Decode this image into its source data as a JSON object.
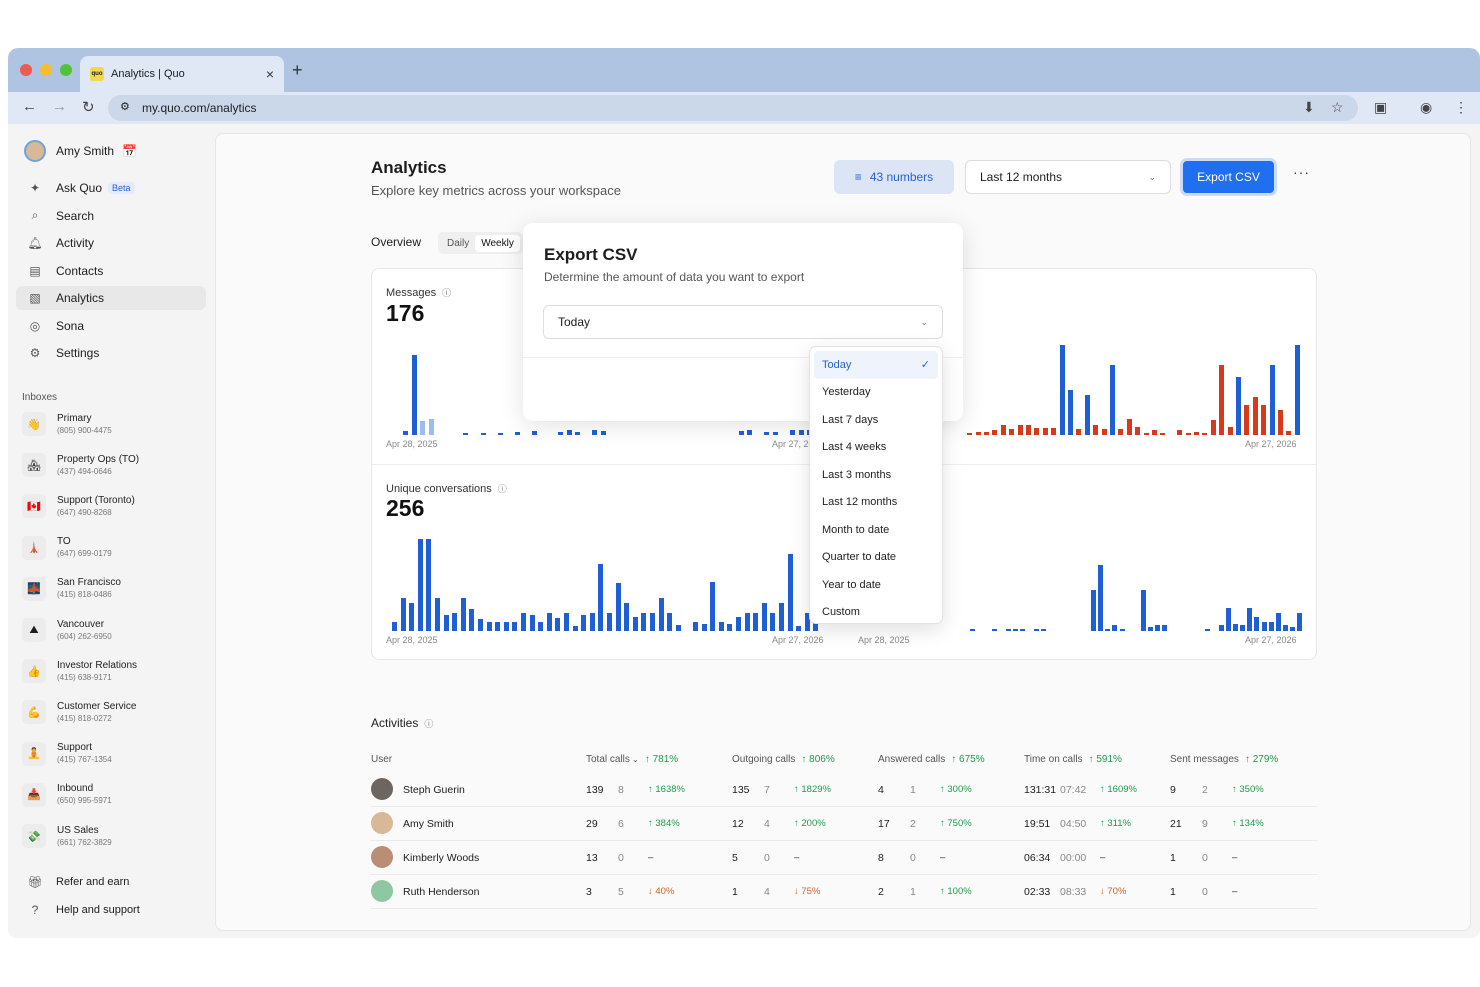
{
  "browser": {
    "tab_title": "Analytics | Quo",
    "favicon_text": "quo",
    "url": "my.quo.com/analytics"
  },
  "sidebar": {
    "user_name": "Amy Smith",
    "nav": [
      {
        "label": "Ask Quo",
        "badge": "Beta",
        "icon": "sparkle-icon"
      },
      {
        "label": "Search",
        "icon": "search-icon"
      },
      {
        "label": "Activity",
        "icon": "bell-icon"
      },
      {
        "label": "Contacts",
        "icon": "contacts-icon"
      },
      {
        "label": "Analytics",
        "icon": "analytics-icon",
        "active": true
      },
      {
        "label": "Sona",
        "icon": "sona-icon"
      },
      {
        "label": "Settings",
        "icon": "gear-icon"
      }
    ],
    "inboxes_heading": "Inboxes",
    "inboxes": [
      {
        "emoji": "👋",
        "name": "Primary",
        "phone": "(805) 900-4475"
      },
      {
        "emoji": "🏘",
        "name": "Property Ops (TO)",
        "phone": "(437) 494-0646"
      },
      {
        "emoji": "🇨🇦",
        "name": "Support (Toronto)",
        "phone": "(647) 490-8268"
      },
      {
        "emoji": "🗼",
        "name": "TO",
        "phone": "(647) 699-0179"
      },
      {
        "emoji": "🌉",
        "name": "San Francisco",
        "phone": "(415) 818-0486"
      },
      {
        "emoji": "⛰",
        "name": "Vancouver",
        "phone": "(604) 262-6950"
      },
      {
        "emoji": "👍",
        "name": "Investor Relations",
        "phone": "(415) 638-9171"
      },
      {
        "emoji": "💪",
        "name": "Customer Service",
        "phone": "(415) 818-0272"
      },
      {
        "emoji": "🧘",
        "name": "Support",
        "phone": "(415) 767-1354"
      },
      {
        "emoji": "📥",
        "name": "Inbound",
        "phone": "(650) 995-5971"
      },
      {
        "emoji": "💸",
        "name": "US Sales",
        "phone": "(661) 762-3829"
      }
    ],
    "bottom": [
      {
        "label": "Refer and earn",
        "icon": "gift-icon"
      },
      {
        "label": "Help and support",
        "icon": "help-icon"
      }
    ]
  },
  "header": {
    "title": "Analytics",
    "subtitle": "Explore key metrics across your workspace",
    "numbers_label": "43 numbers",
    "range_label": "Last 12 months",
    "export_label": "Export CSV"
  },
  "overview": {
    "label": "Overview",
    "segments": [
      "Daily",
      "Weekly"
    ]
  },
  "charts": {
    "messages": {
      "label": "Messages",
      "value": "176",
      "start": "Apr 28, 2025",
      "end": "Apr 27, 2026"
    },
    "right_top": {
      "end": "Apr 27, 2026"
    },
    "conversations": {
      "label": "Unique conversations",
      "value": "256",
      "start": "Apr 28, 2025",
      "end": "Apr 27, 2026"
    },
    "right_bottom": {
      "start": "Apr 28, 2025",
      "end": "Apr 27, 2026"
    },
    "colors": {
      "blue": "#1f5fd6",
      "light_blue": "#9bbcec",
      "red": "#d63a1a"
    }
  },
  "activities": {
    "title": "Activities",
    "headers": [
      {
        "label": "User",
        "pct": ""
      },
      {
        "label": "Total calls",
        "pct": "↑ 781%"
      },
      {
        "label": "Outgoing calls",
        "pct": "↑ 806%"
      },
      {
        "label": "Answered calls",
        "pct": "↑ 675%"
      },
      {
        "label": "Time on calls",
        "pct": "↑ 591%"
      },
      {
        "label": "Sent messages",
        "pct": "↑ 279%"
      }
    ],
    "rows": [
      {
        "name": "Steph Guerin",
        "tc": [
          "139",
          "8",
          "↑ 1638%"
        ],
        "oc": [
          "135",
          "7",
          "↑ 1829%"
        ],
        "ac": [
          "4",
          "1",
          "↑ 300%"
        ],
        "tt": [
          "131:31",
          "07:42",
          "↑ 1609%"
        ],
        "sm": [
          "9",
          "2",
          "↑ 350%"
        ]
      },
      {
        "name": "Amy Smith",
        "tc": [
          "29",
          "6",
          "↑ 384%"
        ],
        "oc": [
          "12",
          "4",
          "↑ 200%"
        ],
        "ac": [
          "17",
          "2",
          "↑ 750%"
        ],
        "tt": [
          "19:51",
          "04:50",
          "↑ 311%"
        ],
        "sm": [
          "21",
          "9",
          "↑ 134%"
        ]
      },
      {
        "name": "Kimberly Woods",
        "tc": [
          "13",
          "0",
          "–"
        ],
        "oc": [
          "5",
          "0",
          "–"
        ],
        "ac": [
          "8",
          "0",
          "–"
        ],
        "tt": [
          "06:34",
          "00:00",
          "–"
        ],
        "sm": [
          "1",
          "0",
          "–"
        ]
      },
      {
        "name": "Ruth Henderson",
        "tc": [
          "3",
          "5",
          "↓ 40%"
        ],
        "oc": [
          "1",
          "4",
          "↓ 75%"
        ],
        "ac": [
          "2",
          "1",
          "↑ 100%"
        ],
        "tt": [
          "02:33",
          "08:33",
          "↓ 70%"
        ],
        "sm": [
          "1",
          "0",
          "–"
        ]
      }
    ]
  },
  "modal": {
    "title": "Export CSV",
    "subtitle": "Determine the amount of data you want to export",
    "selected": "Today",
    "options": [
      "Today",
      "Yesterday",
      "Last 7 days",
      "Last 4 weeks",
      "Last 3 months",
      "Last 12 months",
      "Month to date",
      "Quarter to date",
      "Year to date",
      "Custom"
    ]
  }
}
